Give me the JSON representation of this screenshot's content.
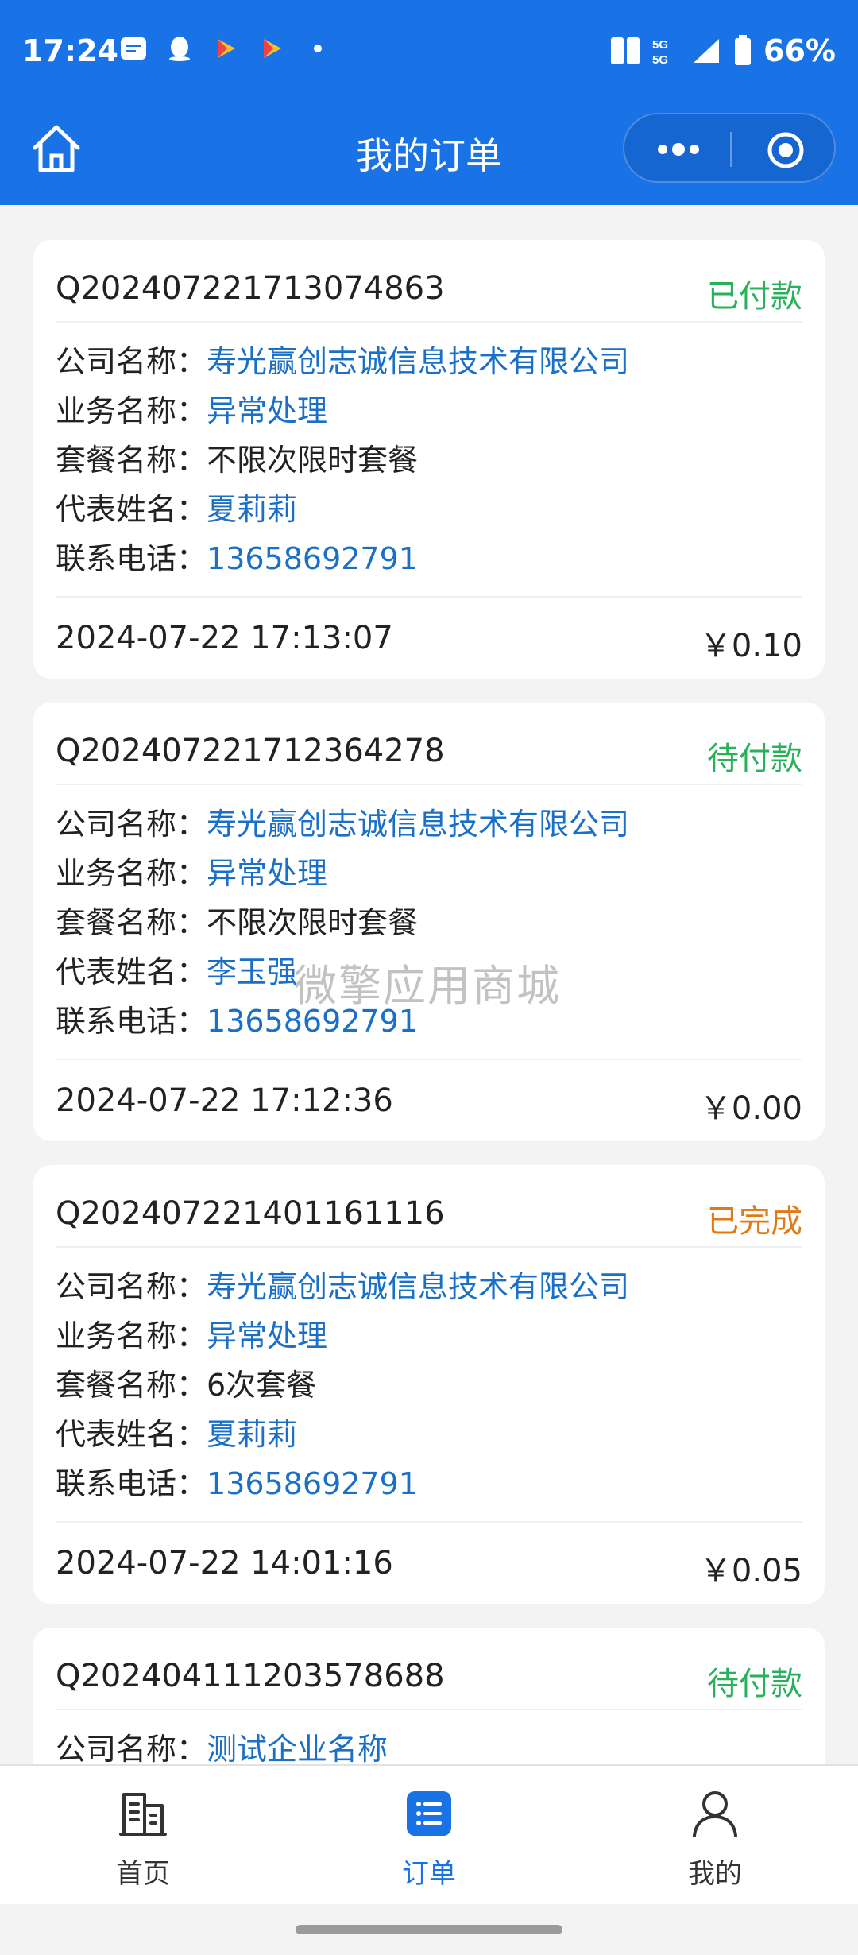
{
  "status_bar": {
    "time": "17:24",
    "battery": "66%"
  },
  "nav": {
    "title": "我的订单"
  },
  "orders": [
    {
      "order_no": "Q202407221713074863",
      "status": "已付款",
      "status_color": "#27b25a",
      "company_label": "公司名称：",
      "company": "寿光赢创志诚信息技术有限公司",
      "business_label": "业务名称：",
      "business": "异常处理",
      "package_label": "套餐名称：",
      "package": "不限次限时套餐",
      "rep_label": "代表姓名：",
      "rep": "夏莉莉",
      "phone_label": "联系电话：",
      "phone": "13658692791",
      "time": "2024-07-22 17:13:07",
      "price": "￥0.10"
    },
    {
      "order_no": "Q202407221712364278",
      "status": "待付款",
      "status_color": "#27b25a",
      "company_label": "公司名称：",
      "company": "寿光赢创志诚信息技术有限公司",
      "business_label": "业务名称：",
      "business": "异常处理",
      "package_label": "套餐名称：",
      "package": "不限次限时套餐",
      "rep_label": "代表姓名：",
      "rep": "李玉强",
      "phone_label": "联系电话：",
      "phone": "13658692791",
      "time": "2024-07-22 17:12:36",
      "price": "￥0.00"
    },
    {
      "order_no": "Q202407221401161116",
      "status": "已完成",
      "status_color": "#e07a16",
      "company_label": "公司名称：",
      "company": "寿光赢创志诚信息技术有限公司",
      "business_label": "业务名称：",
      "business": "异常处理",
      "package_label": "套餐名称：",
      "package": "6次套餐",
      "rep_label": "代表姓名：",
      "rep": "夏莉莉",
      "phone_label": "联系电话：",
      "phone": "13658692791",
      "time": "2024-07-22 14:01:16",
      "price": "￥0.05"
    },
    {
      "order_no": "Q202404111203578688",
      "status": "待付款",
      "status_color": "#27b25a",
      "company_label": "公司名称：",
      "company": "测试企业名称"
    }
  ],
  "watermark": "微擎应用商城",
  "tabs": [
    {
      "label": "首页",
      "icon": "building-icon"
    },
    {
      "label": "订单",
      "icon": "list-icon"
    },
    {
      "label": "我的",
      "icon": "user-icon"
    }
  ],
  "colors": {
    "primary": "#1a73e6",
    "link": "#1a6fc8",
    "paid": "#27b25a",
    "done": "#e07a16"
  }
}
